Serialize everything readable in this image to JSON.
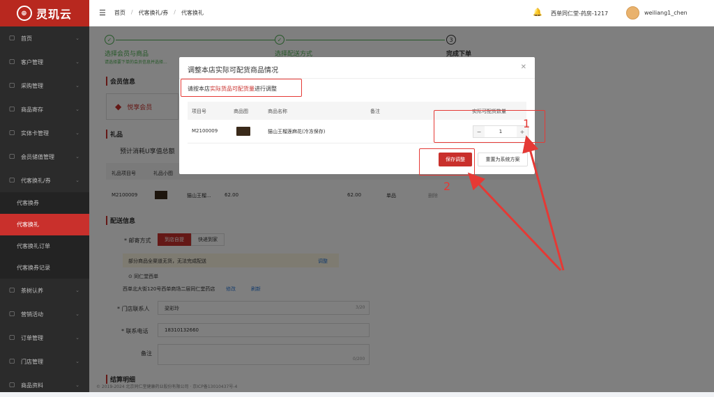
{
  "app": {
    "logo_text": "灵玑云"
  },
  "sidebar": {
    "items": [
      {
        "label": "首页",
        "icon": "grid-icon"
      },
      {
        "label": "客户管理",
        "icon": "user-icon"
      },
      {
        "label": "采购管理",
        "icon": "cart-icon"
      },
      {
        "label": "商品寄存",
        "icon": "box-icon"
      },
      {
        "label": "实体卡管理",
        "icon": "card-icon"
      },
      {
        "label": "会员储值管理",
        "icon": "wallet-icon"
      },
      {
        "label": "代客换礼/券",
        "icon": "gift-icon"
      }
    ],
    "sub_items": [
      {
        "label": "代客换券"
      },
      {
        "label": "代客换礼"
      },
      {
        "label": "代客换礼订单"
      },
      {
        "label": "代客换券记录"
      }
    ],
    "items_after": [
      {
        "label": "茶树认养"
      },
      {
        "label": "营销活动"
      },
      {
        "label": "订单管理"
      },
      {
        "label": "门店管理"
      },
      {
        "label": "商品资料"
      }
    ]
  },
  "topbar": {
    "breadcrumb": [
      "首页",
      "代客换礼/券",
      "代客换礼"
    ],
    "store": "西单同仁堂-药房-1217",
    "user": "weiliang1_chen"
  },
  "steps": [
    {
      "title": "选择会员与商品",
      "desc": "请选择要下单的会员信息并选择..."
    },
    {
      "title": "选择配送方式",
      "desc": ""
    },
    {
      "title": "完成下单",
      "num": "3"
    }
  ],
  "page": {
    "member_section": "会员信息",
    "member_tier": "悦享会员",
    "gift_section": "礼品",
    "gift_summary": "预计消耗U享值总额",
    "gift_cols": [
      "礼品项目号",
      "礼品小图"
    ],
    "gift_row": {
      "code": "M2100009",
      "name": "猫山王榴...",
      "price": "62.00",
      "price2": "62.00",
      "unit": "单品",
      "del": "删除"
    },
    "delivery_section": "配送信息",
    "ship_label": "邮寄方式",
    "ship_options": [
      "到店自提",
      "快递到家"
    ],
    "warning": "部分商品全渠道无货，无法完成配送",
    "adjust_link": "调整",
    "store_name": "同仁堂西单",
    "address": "西单北大街120号西单商场二层同仁堂药店",
    "modify": "修改",
    "refresh": "刷新",
    "contact_label": "门店联系人",
    "contact_value": "梁彩玲",
    "contact_count": "3/20",
    "phone_label": "联系电话",
    "phone_value": "18310132660",
    "remark_label": "备注",
    "remark_count": "0/200",
    "settle_section": "结算明细",
    "footer": "© 2019-2024 北京同仁堂健康药业股份有限公司 · 京ICP备13010437号-4"
  },
  "modal": {
    "title": "调整本店实际可配货商品情况",
    "hint_pre": "请按本店",
    "hint_red": "实际货品可配货量",
    "hint_post": "进行调整",
    "columns": [
      "项目号",
      "商品图",
      "商品名称",
      "备注",
      "实际可配货数量"
    ],
    "row": {
      "code": "M2100009",
      "name": "猫山王榴莲麻花(冷冻保存)",
      "remark": "",
      "qty": "1"
    },
    "save_label": "保存调整",
    "reset_label": "重置为系统方案"
  },
  "annotations": {
    "label1": "1",
    "label2": "2",
    "color": "#e53935"
  }
}
